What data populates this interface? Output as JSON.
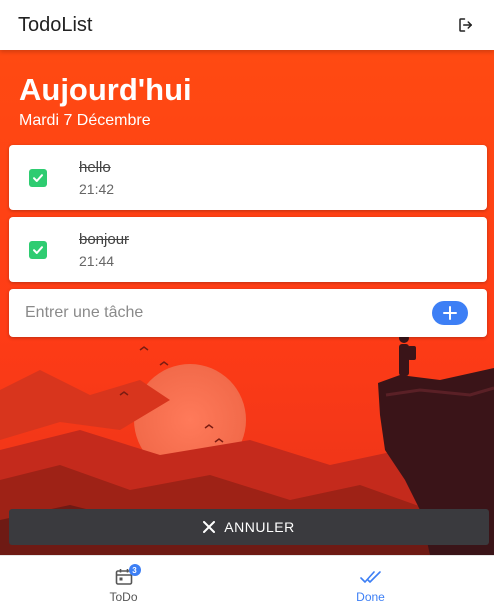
{
  "app": {
    "title": "TodoList"
  },
  "header": {
    "heading": "Aujourd'hui",
    "date": "Mardi 7 Décembre"
  },
  "tasks": [
    {
      "name": "hello",
      "time": "21:42",
      "done": true
    },
    {
      "name": "bonjour",
      "time": "21:44",
      "done": true
    }
  ],
  "entry": {
    "placeholder": "Entrer une tâche",
    "value": ""
  },
  "cancel": {
    "label": "ANNULER"
  },
  "nav": {
    "todo": {
      "label": "ToDo",
      "badge": "3"
    },
    "done": {
      "label": "Done"
    }
  },
  "colors": {
    "accent": "#3d7ff5",
    "check": "#2ecc71",
    "sky": "#ff4a12",
    "cancel_bg": "#3a3a3e"
  },
  "icons": {
    "logout": "logout-icon",
    "check": "checkbox-checked-icon",
    "add": "plus-icon",
    "close": "close-icon",
    "calendar": "calendar-icon",
    "done": "double-check-icon"
  }
}
